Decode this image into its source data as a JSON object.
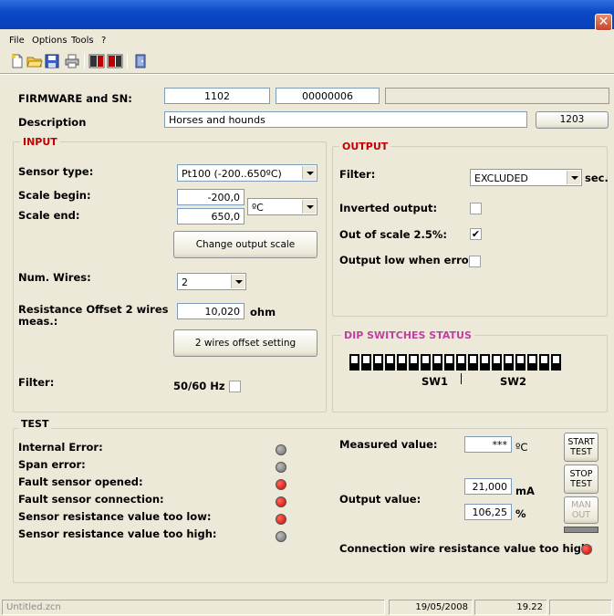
{
  "window": {
    "close_symbol": "✕"
  },
  "menu": {
    "file": "File",
    "options": "Options",
    "tools": "Tools",
    "help": "?"
  },
  "toolbar": {
    "icons": [
      "new-file-icon",
      "open-folder-icon",
      "save-icon",
      "print-icon",
      "pc-to-device-icon",
      "device-to-pc-icon",
      "exit-icon"
    ]
  },
  "header": {
    "firmware_label": "FIRMWARE and SN:",
    "firmware": "1102",
    "serial": "00000006",
    "extra": "",
    "description_label": "Description",
    "description": "Horses and hounds",
    "description_code": "1203"
  },
  "input": {
    "title": "INPUT",
    "sensor_type_label": "Sensor type:",
    "sensor_type": "Pt100 (-200..650ºC)",
    "scale_begin_label": "Scale begin:",
    "scale_begin": "-200,0",
    "scale_end_label": "Scale end:",
    "scale_end": "650,0",
    "unit": "ºC",
    "change_scale_button": "Change output scale",
    "num_wires_label": "Num. Wires:",
    "num_wires": "2",
    "offset_label": "Resistance Offset 2 wires meas.:",
    "offset_value": "10,020",
    "offset_unit": "ohm",
    "offset_button": "2 wires offset setting",
    "filter_label": "Filter:",
    "filter_value_label": "50/60 Hz",
    "filter_checked": false
  },
  "output": {
    "title": "OUTPUT",
    "filter_label": "Filter:",
    "filter_value": "EXCLUDED",
    "filter_unit": "sec.",
    "inverted_label": "Inverted output:",
    "inverted_checked": false,
    "out_of_scale_label": "Out of scale 2.5%:",
    "out_of_scale_checked": true,
    "low_on_error_label": "Output low when error:",
    "low_on_error_checked": false
  },
  "dip": {
    "title": "DIP SWITCHES STATUS",
    "sw1": "SW1",
    "sw2": "SW2",
    "switch_count": 18
  },
  "test": {
    "title": "TEST",
    "errors": [
      {
        "label": "Internal Error:",
        "state": "gray"
      },
      {
        "label": "Span error:",
        "state": "gray"
      },
      {
        "label": "Fault sensor opened:",
        "state": "red"
      },
      {
        "label": "Fault sensor connection:",
        "state": "red"
      },
      {
        "label": "Sensor resistance value too low:",
        "state": "red"
      },
      {
        "label": "Sensor resistance value too high:",
        "state": "gray"
      }
    ],
    "measured_label": "Measured value:",
    "measured_value": "***",
    "measured_unit": "ºC",
    "output_label": "Output value:",
    "output_ma": "21,000",
    "output_ma_unit": "mA",
    "output_pct": "106,25",
    "output_pct_unit": "%",
    "start_button": "START TEST",
    "stop_button": "STOP TEST",
    "man_button": "MAN OUT",
    "wire_res_label": "Connection wire resistance value too high:",
    "wire_res_state": "red"
  },
  "status": {
    "file": "Untitled.zcn",
    "date": "19/05/2008",
    "time": "19.22"
  },
  "colors": {
    "accent_red": "#c00000",
    "dip_title": "#c040a0",
    "led_red": "#e00000",
    "led_gray": "#888888"
  }
}
